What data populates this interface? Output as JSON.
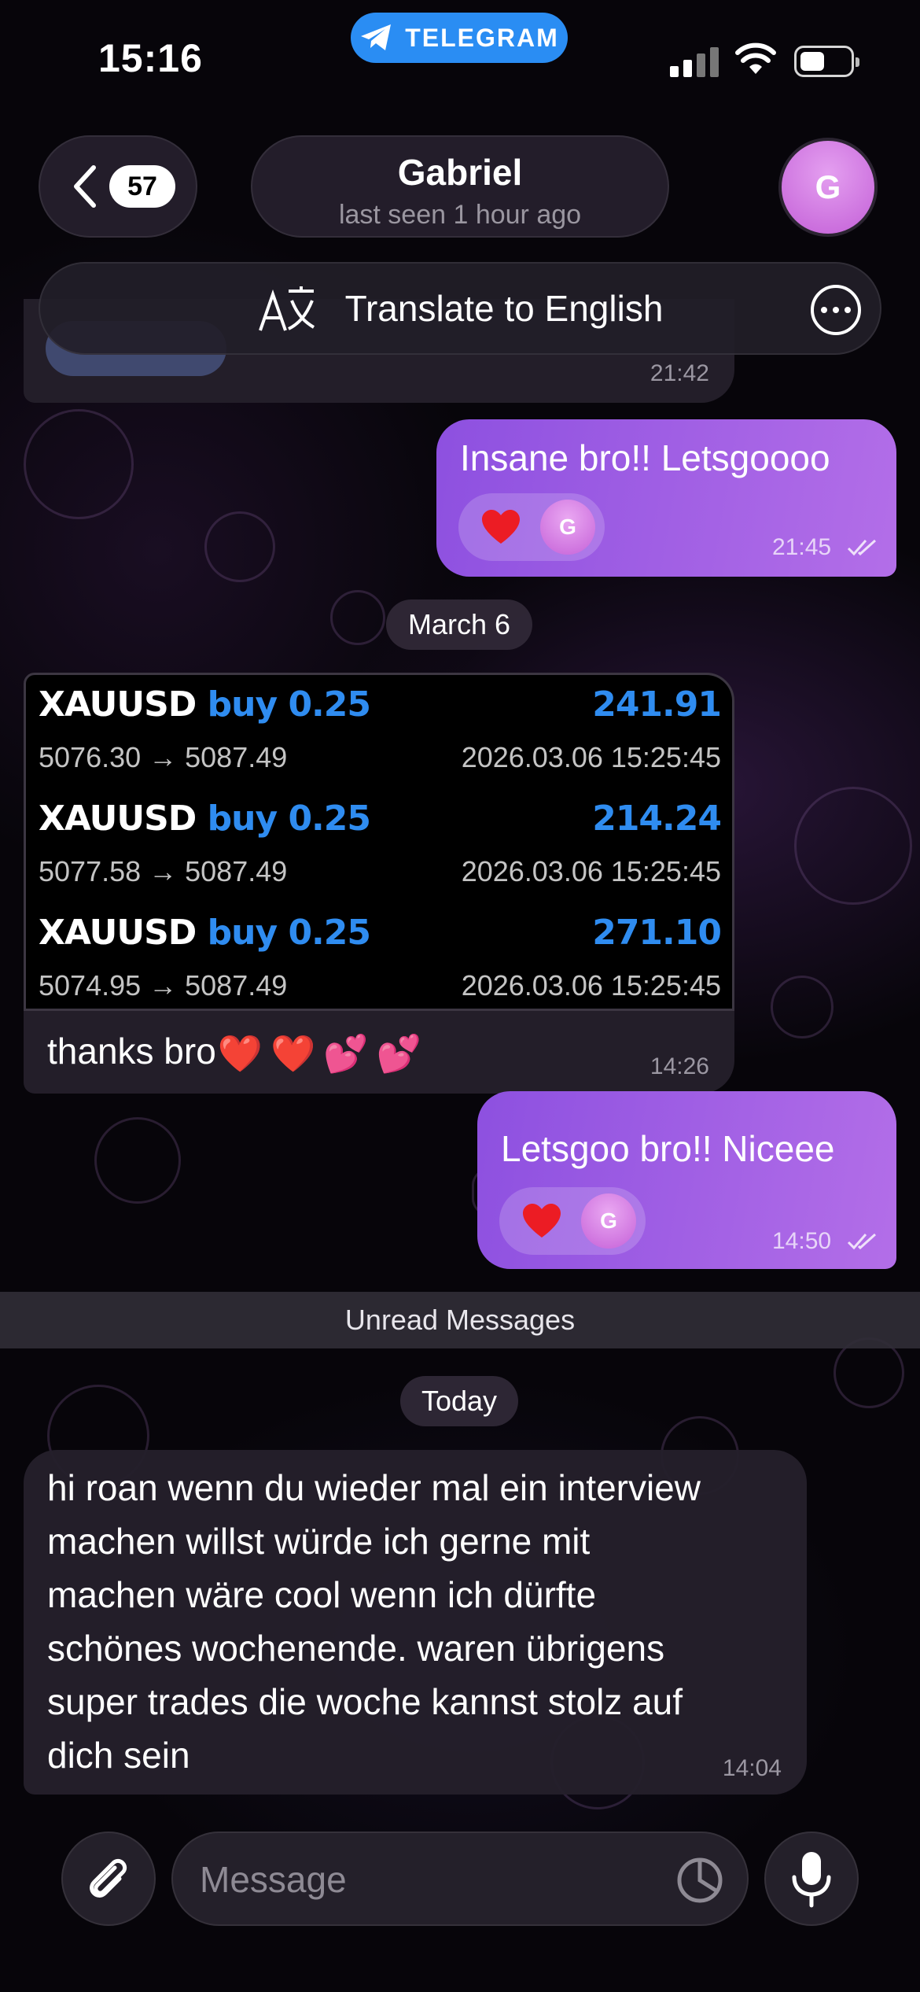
{
  "status_bar": {
    "time": "15:16",
    "app_label": "TELEGRAM"
  },
  "header": {
    "back_count": "57",
    "contact_name": "Gabriel",
    "last_seen": "last seen 1 hour ago",
    "avatar_initial": "G"
  },
  "translate_bar": {
    "label": "Translate to English"
  },
  "messages": [
    {
      "id": "prev-in",
      "direction": "in",
      "time": "21:42"
    },
    {
      "id": "out-1",
      "direction": "out",
      "text": "Insane bro!! Letsgoooo",
      "time": "21:45",
      "read": true,
      "reaction": "heart",
      "reactor_initial": "G"
    },
    {
      "id": "trades",
      "direction": "in",
      "caption": "thanks bro",
      "caption_emojis": [
        "❤️",
        "❤️",
        "💕",
        "💕"
      ],
      "time": "14:26"
    },
    {
      "id": "out-2",
      "direction": "out",
      "text": "Letsgoo bro!! Niceee",
      "time": "14:50",
      "read": true,
      "reaction": "heart",
      "reactor_initial": "G"
    },
    {
      "id": "in-long",
      "direction": "in",
      "lines": [
        "hi roan wenn du wieder mal ein interview",
        "machen willst würde ich gerne mit",
        "machen wäre cool wenn ich dürfte",
        "schönes wochenende. waren übrigens",
        "super trades die woche kannst stolz auf",
        "dich sein"
      ],
      "time": "14:04"
    }
  ],
  "date_separators": {
    "march": "March 6",
    "today": "Today"
  },
  "unread_label": "Unread Messages",
  "trades": [
    {
      "symbol": "XAUUSD",
      "side": "buy 0.25",
      "profit": "241.91",
      "prices": "5076.30 → 5087.49",
      "datetime": "2026.03.06 15:25:45"
    },
    {
      "symbol": "XAUUSD",
      "side": "buy 0.25",
      "profit": "214.24",
      "prices": "5077.58 → 5087.49",
      "datetime": "2026.03.06 15:25:45"
    },
    {
      "symbol": "XAUUSD",
      "side": "buy 0.25",
      "profit": "271.10",
      "prices": "5074.95 → 5087.49",
      "datetime": "2026.03.06 15:25:45"
    }
  ],
  "input": {
    "placeholder": "Message"
  },
  "icons": [
    "telegram-icon",
    "chevron-left-icon",
    "translate-icon",
    "more-icon",
    "heart-icon",
    "paperclip-icon",
    "sticker-icon",
    "microphone-icon"
  ],
  "colors": {
    "outgoing_bubble": "#a060e6",
    "telegram_blue": "#2a8df3",
    "trade_blue": "#2f8cf0",
    "avatar": "#d77ee6"
  }
}
